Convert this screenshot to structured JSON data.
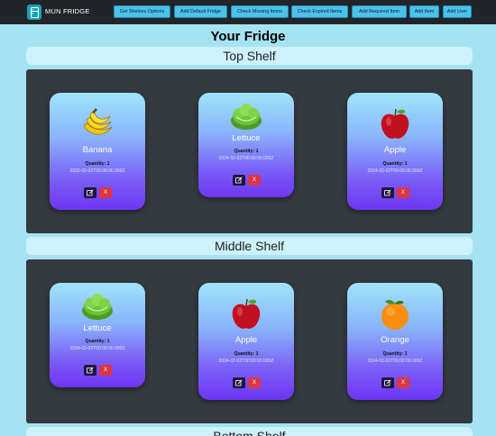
{
  "navbar": {
    "brand": "MUN FRIDGE",
    "buttons": [
      "Get Shelves Options",
      "Add Default Fridge",
      "Check Missing Items",
      "Check Expired Items",
      "Add Required Item",
      "Add Item",
      "Add User"
    ]
  },
  "page_title": "Your Fridge",
  "shelves": [
    {
      "label": "Top Shelf",
      "items": [
        {
          "name": "Banana",
          "quantity": "Quantity: 1",
          "date": "2022-02-02T00:00:00.000Z",
          "icon": "banana-icon",
          "del": "X"
        },
        {
          "name": "Lettuce",
          "quantity": "Quantity: 1",
          "date": "2024-02-02T00:00:00.000Z",
          "icon": "lettuce-icon",
          "del": "X"
        },
        {
          "name": "Apple",
          "quantity": "Quantity: 1",
          "date": "2024-02-02T00:00:00.000Z",
          "icon": "apple-icon",
          "del": "X"
        }
      ]
    },
    {
      "label": "Middle Shelf",
      "items": [
        {
          "name": "Lettuce",
          "quantity": "Quantity: 1",
          "date": "2024-02-02T00:00:00.000Z",
          "icon": "lettuce-icon",
          "del": "X"
        },
        {
          "name": "Apple",
          "quantity": "Quantity: 1",
          "date": "2024-02-02T00:00:00.000Z",
          "icon": "apple-icon",
          "del": "X"
        },
        {
          "name": "Orange",
          "quantity": "Quantity: 1",
          "date": "2024-02-02T00:00:00.000Z",
          "icon": "orange-icon",
          "del": "X"
        }
      ]
    },
    {
      "label": "Bottom Shelf",
      "items": []
    }
  ]
}
